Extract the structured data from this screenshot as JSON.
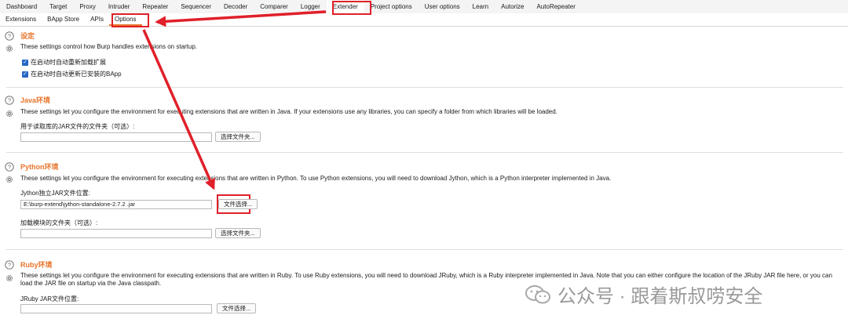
{
  "main_tabs": [
    "Dashboard",
    "Target",
    "Proxy",
    "Intruder",
    "Repeater",
    "Sequencer",
    "Decoder",
    "Comparer",
    "Logger",
    "Extender",
    "Project options",
    "User options",
    "Learn",
    "Autorize",
    "AutoRepeater"
  ],
  "sub_tabs": [
    "Extensions",
    "BApp Store",
    "APIs",
    "Options"
  ],
  "settings": {
    "title": "设定",
    "desc": "These settings control how Burp handles extensions on startup.",
    "checkbox1": "在启动时自动重新加载扩展",
    "checkbox2": "在启动时自动更新已安装的BApp"
  },
  "java": {
    "title": "Java环境",
    "desc": "These settings let you configure the environment for executing extensions that are written in Java. If your extensions use any libraries, you can specify a folder from which libraries will be loaded.",
    "label": "用于读取库的JAR文件的文件夹（可选）:",
    "value": "",
    "button": "选择文件夹..."
  },
  "python": {
    "title": "Python环境",
    "desc": "These settings let you configure the environment for executing extensions that are written in Python. To use Python extensions, you will need to download Jython, which is a Python interpreter implemented in Java.",
    "label1": "Jython独立JAR文件位置:",
    "value1": "E:\\burp-extend\\jython-standalone-2.7.2 .jar",
    "button1": "文件选择...",
    "label2": "加载模块的文件夹（可选）:",
    "value2": "",
    "button2": "选择文件夹..."
  },
  "ruby": {
    "title": "Ruby环境",
    "desc": "These settings let you configure the environment for executing extensions that are written in Ruby. To use Ruby extensions, you will need to download JRuby, which is a Ruby interpreter implemented in Java. Note that you can either configure the location of the JRuby JAR file here, or you can load the JAR file on startup via the Java classpath.",
    "label": "JRuby JAR文件位置:",
    "value": "",
    "button": "文件选择..."
  },
  "watermark": "公众号 · 跟着斯叔唠安全",
  "colors": {
    "accent": "#e8742a",
    "annotation": "#e0202a"
  }
}
